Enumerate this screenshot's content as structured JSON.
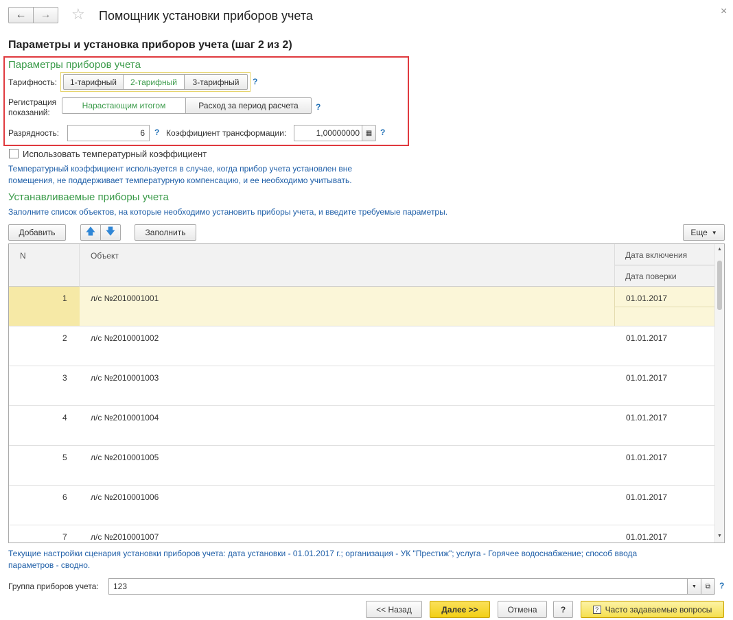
{
  "window": {
    "title": "Помощник установки приборов учета",
    "step_title": "Параметры и установка приборов учета (шаг 2 из 2)"
  },
  "params": {
    "section_title": "Параметры приборов учета",
    "tariff_label": "Тарифность:",
    "tariff_options": [
      "1-тарифный",
      "2-тарифный",
      "3-тарифный"
    ],
    "tariff_selected": "2-тарифный",
    "registration_label_1": "Регистрация",
    "registration_label_2": "показаний:",
    "registration_options": [
      "Нарастающим итогом",
      "Расход за период расчета"
    ],
    "registration_selected": "Нарастающим итогом",
    "digits_label": "Разрядность:",
    "digits_value": "6",
    "ratio_label": "Коэффициент трансформации:",
    "ratio_value": "1,00000000",
    "help": "?"
  },
  "temp": {
    "checkbox_label": "Использовать температурный коэффициент",
    "checked": false,
    "note_line1": "Температурный коэффициент используется в случае, когда прибор учета установлен вне",
    "note_line2": "помещения, не поддерживает температурную компенсацию, и ее необходимо учитывать."
  },
  "devices": {
    "section_title": "Устанавливаемые приборы учета",
    "note": "Заполните список объектов, на которые необходимо установить приборы учета, и введите требуемые параметры."
  },
  "toolbar": {
    "add": "Добавить",
    "fill": "Заполнить",
    "more": "Еще"
  },
  "table": {
    "col_n": "N",
    "col_object": "Объект",
    "col_date_on": "Дата включения",
    "col_date_check": "Дата поверки",
    "rows": [
      {
        "n": "1",
        "object": "л/с №2010001001",
        "date_on": "01.01.2017",
        "date_check": ""
      },
      {
        "n": "2",
        "object": "л/с №2010001002",
        "date_on": "01.01.2017",
        "date_check": ""
      },
      {
        "n": "3",
        "object": "л/с №2010001003",
        "date_on": "01.01.2017",
        "date_check": ""
      },
      {
        "n": "4",
        "object": "л/с №2010001004",
        "date_on": "01.01.2017",
        "date_check": ""
      },
      {
        "n": "5",
        "object": "л/с №2010001005",
        "date_on": "01.01.2017",
        "date_check": ""
      },
      {
        "n": "6",
        "object": "л/с №2010001006",
        "date_on": "01.01.2017",
        "date_check": ""
      },
      {
        "n": "7",
        "object": "л/с №2010001007",
        "date_on": "01.01.2017",
        "date_check": ""
      }
    ]
  },
  "footer": {
    "note_line1": "Текущие настройки сценария установки приборов учета: дата установки - 01.01.2017 г.; организация - УК \"Престиж\"; услуга - Горячее водоснабжение; способ ввода",
    "note_line2": "параметров - сводно.",
    "group_label": "Группа приборов учета:",
    "group_value": "123",
    "back": "<< Назад",
    "next": "Далее >>",
    "cancel": "Отмена",
    "help": "?",
    "faq": "Часто задаваемые вопросы"
  },
  "colors": {
    "accent_green": "#3b9b4a",
    "link_blue": "#1f5fa8",
    "highlight_red": "#e0393e",
    "selected_row": "#fbf6d8",
    "primary_button": "#f5d31c"
  }
}
